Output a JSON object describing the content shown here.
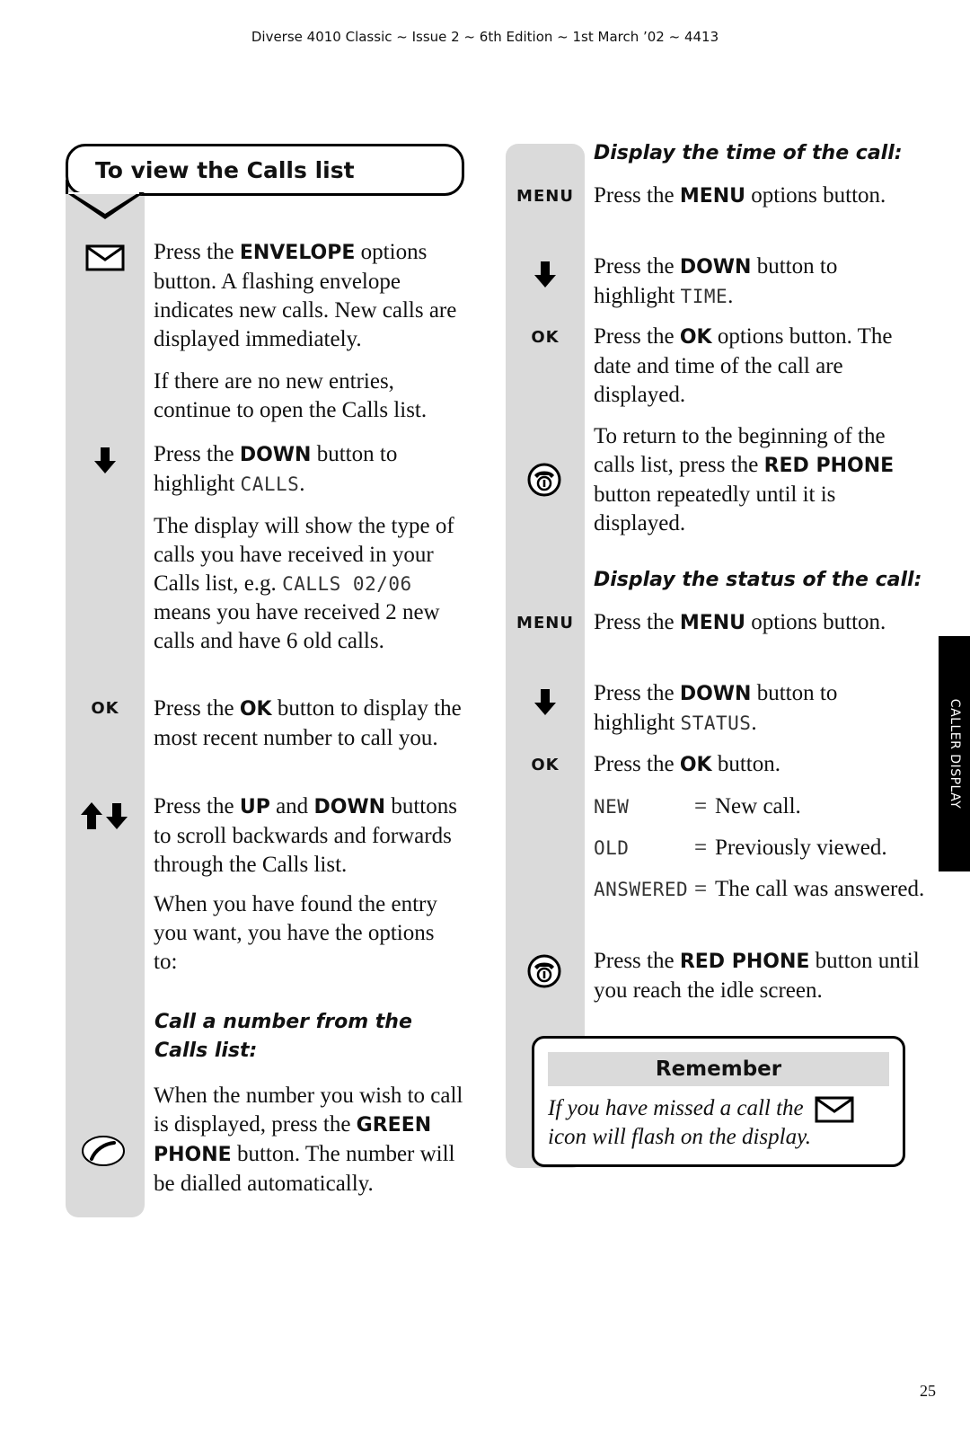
{
  "header": {
    "text": "Diverse 4010 Classic ~ Issue 2 ~ 6th Edition ~ 1st March ’02 ~ 4413"
  },
  "page_number": "25",
  "side_tab": {
    "label": "CALLER DISPLAY"
  },
  "section": {
    "title": "To view the Calls list"
  },
  "left_column": {
    "steps": [
      {
        "icon": "envelope-icon",
        "pre": "Press the ",
        "bold": "ENVELOPE",
        "post": " options button. A flashing envelope indicates new calls. New calls are displayed immediately."
      },
      {
        "icon": "",
        "text": "If there are no new entries, continue to open the Calls list."
      },
      {
        "icon": "down-arrow-icon",
        "pre": "Press the ",
        "bold": "DOWN",
        "mid": " button to highlight ",
        "lcd": "CALLS",
        "post": "."
      },
      {
        "icon": "",
        "pre": "The display will show the type of calls you have received in your Calls list, e.g. ",
        "lcd": "CALLS 02/06",
        "post": " means you have received 2 new calls and have 6 old calls."
      },
      {
        "icon": "ok-label",
        "icon_label": "OK",
        "pre": "Press the ",
        "bold": "OK",
        "post": " button to display the most recent number to call you."
      },
      {
        "icon": "up-down-arrows-icon",
        "pre": "Press the ",
        "bold": "UP",
        "mid": " and ",
        "bold2": "DOWN",
        "post": " buttons to scroll backwards and forwards through the Calls list."
      },
      {
        "icon": "",
        "text": "When you have found the entry you want, you have the options to:"
      }
    ],
    "subheading": "Call a number from the Calls list:",
    "call_step": {
      "icon": "green-phone-icon",
      "pre": "When the number you wish to call is displayed, press the ",
      "bold": "GREEN PHONE",
      "post": " button. The number will be dialled automatically."
    }
  },
  "right_column": {
    "subheading_time": "Display the time of the call:",
    "time_steps": [
      {
        "icon_label": "MENU",
        "pre": "Press the ",
        "bold": "MENU",
        "post": " options button."
      },
      {
        "icon": "down-arrow-icon",
        "pre": "Press the ",
        "bold": "DOWN",
        "mid": " button to highlight ",
        "lcd": "TIME",
        "post": "."
      },
      {
        "icon_label": "OK",
        "pre": "Press the ",
        "bold": "OK",
        "post": " options button. The date and time of the call are displayed."
      },
      {
        "icon": "red-phone-icon",
        "pre": "To return to the beginning of the calls list, press the ",
        "bold": "RED PHONE",
        "post": " button repeatedly until it is displayed."
      }
    ],
    "subheading_status": "Display the status of the call:",
    "status_steps": [
      {
        "icon_label": "MENU",
        "pre": "Press the ",
        "bold": "MENU",
        "post": " options button."
      },
      {
        "icon": "down-arrow-icon",
        "pre": "Press the ",
        "bold": "DOWN",
        "mid": " button to highlight ",
        "lcd": "STATUS",
        "post": "."
      },
      {
        "icon_label": "OK",
        "pre": "Press the ",
        "bold": "OK",
        "post": " button."
      }
    ],
    "status_values": [
      {
        "key": "NEW",
        "eq": "=",
        "desc": "New call."
      },
      {
        "key": "OLD",
        "eq": "=",
        "desc": "Previously viewed."
      },
      {
        "key": "ANSWERED",
        "eq": "=",
        "desc": "The call was answered."
      }
    ],
    "final_step": {
      "icon": "red-phone-icon",
      "pre": "Press the ",
      "bold": "RED PHONE",
      "post": " button until you reach the idle screen."
    }
  },
  "remember": {
    "title": "Remember",
    "body_pre": "If you have missed a call the",
    "body_post": "icon will flash on the display."
  }
}
